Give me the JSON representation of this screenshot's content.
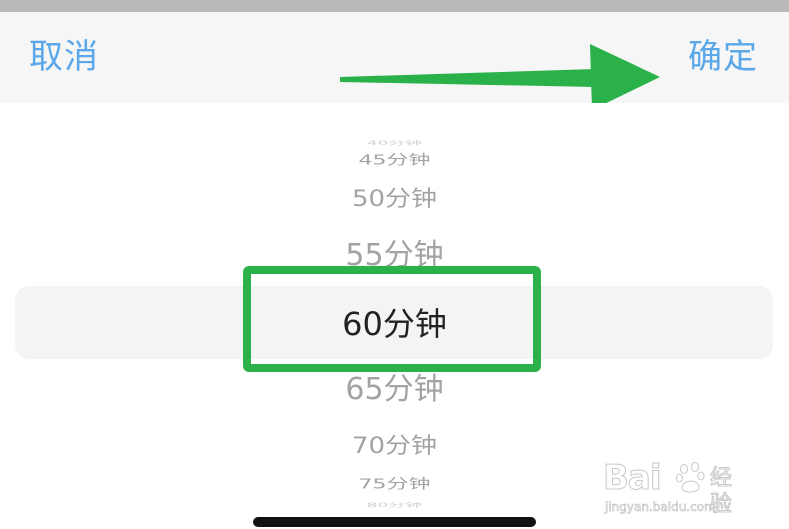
{
  "toolbar": {
    "cancel_label": "取消",
    "confirm_label": "确定"
  },
  "picker": {
    "options": [
      "40分钟",
      "45分钟",
      "50分钟",
      "55分钟",
      "60分钟",
      "65分钟",
      "70分钟",
      "75分钟",
      "80分钟"
    ],
    "selected": "60分钟"
  },
  "annotations": {
    "arrow_color": "#2bb14a",
    "highlight_color": "#2bb14a"
  },
  "watermark": {
    "logo": "Bai",
    "logo_tail": "du",
    "name": "经验",
    "url": "jingyan.baidu.com"
  },
  "colors": {
    "accent": "#5aa7ea",
    "selected_text": "#222222",
    "unselected_text": "#a3a3a3"
  }
}
